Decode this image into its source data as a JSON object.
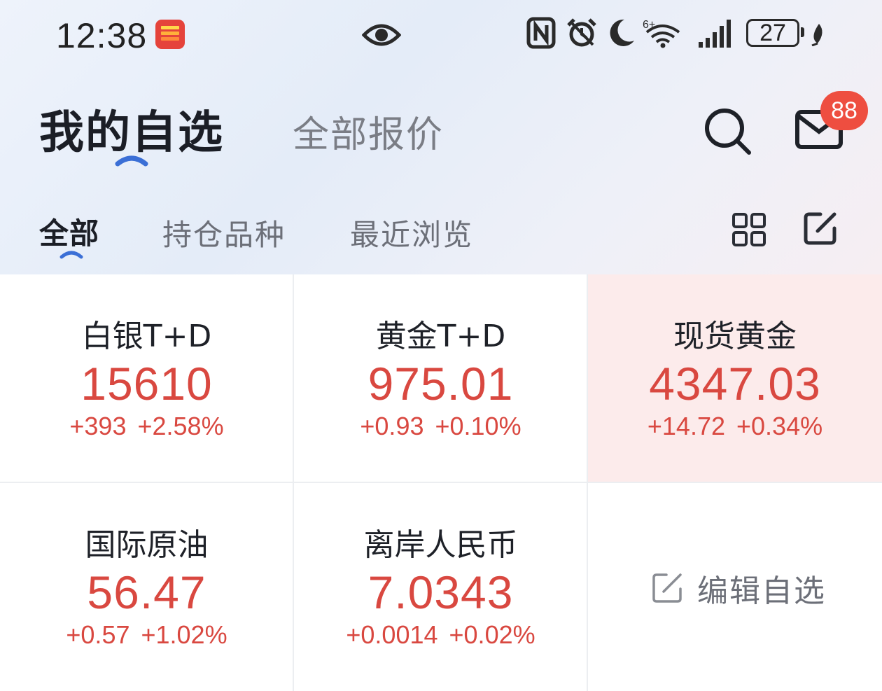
{
  "status_bar": {
    "time": "12:38",
    "battery": "27",
    "icons": [
      "huawei-app-icon",
      "eye-icon",
      "nfc-icon",
      "alarm-icon",
      "moon-icon",
      "wifi-6-icon",
      "signal-icon",
      "battery-icon",
      "leaf-icon"
    ]
  },
  "header": {
    "tabs": [
      {
        "label": "我的自选",
        "active": true
      },
      {
        "label": "全部报价",
        "active": false
      }
    ],
    "search_icon": "search-icon",
    "mail_icon": "mail-icon",
    "mail_badge": "88"
  },
  "sub_tabs": [
    {
      "label": "全部",
      "active": true
    },
    {
      "label": "持仓品种",
      "active": false
    },
    {
      "label": "最近浏览",
      "active": false
    }
  ],
  "toolbar_icons": [
    "grid-view-icon",
    "edit-icon"
  ],
  "quotes": [
    {
      "name": "白银T+D",
      "price": "15610",
      "change": "+393",
      "change_pct": "+2.58%",
      "highlight": false
    },
    {
      "name": "黄金T+D",
      "price": "975.01",
      "change": "+0.93",
      "change_pct": "+0.10%",
      "highlight": false
    },
    {
      "name": "现货黄金",
      "price": "4347.03",
      "change": "+14.72",
      "change_pct": "+0.34%",
      "highlight": true
    },
    {
      "name": "国际原油",
      "price": "56.47",
      "change": "+0.57",
      "change_pct": "+1.02%",
      "highlight": false
    },
    {
      "name": "离岸人民币",
      "price": "7.0343",
      "change": "+0.0014",
      "change_pct": "+0.02%",
      "highlight": false
    }
  ],
  "edit_watchlist": {
    "label": "编辑自选",
    "icon": "edit-icon"
  },
  "colors": {
    "up": "#d94840",
    "accent": "#3b6fd6",
    "badge": "#ee4e40",
    "highlight_bg": "#fcebeb"
  }
}
